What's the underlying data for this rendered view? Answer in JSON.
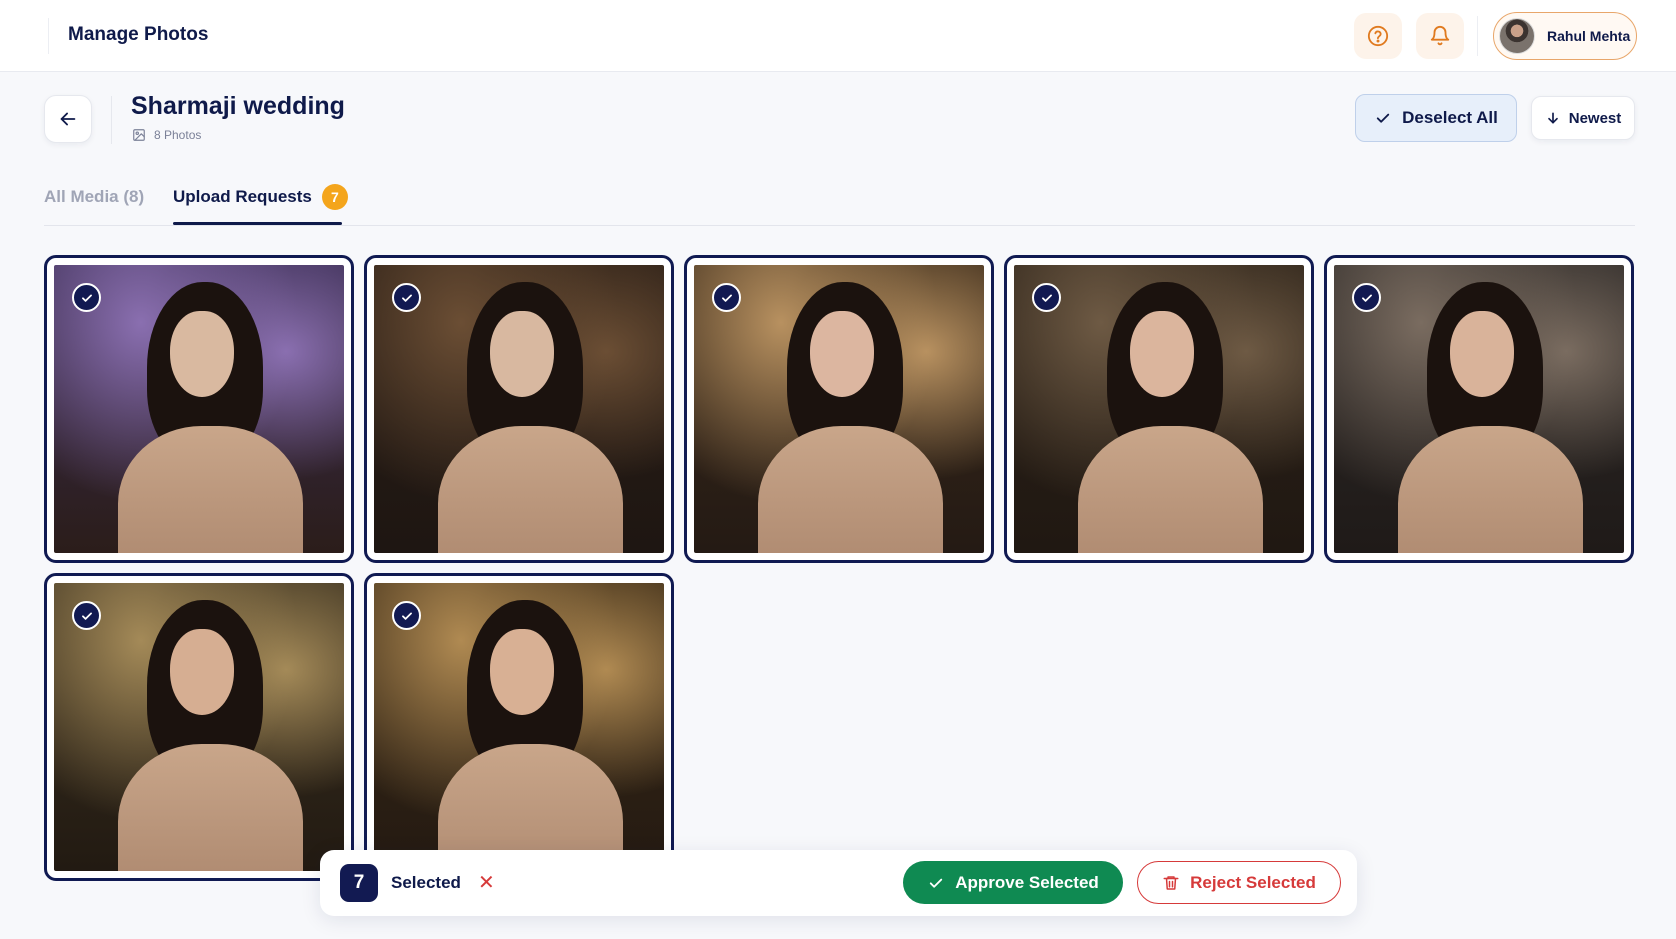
{
  "topbar": {
    "app_title": "Manage Photos",
    "help_icon": "help-circle-icon",
    "bell_icon": "bell-icon",
    "user_name": "Rahul Mehta"
  },
  "header": {
    "album_title": "Sharmaji wedding",
    "photo_count": "8 Photos",
    "deselect_label": "Deselect All",
    "sort_label": "Newest"
  },
  "tabs": [
    {
      "label": "All Media (8)",
      "active": false
    },
    {
      "label": "Upload Requests",
      "badge": "7",
      "active": true
    }
  ],
  "photos": [
    {
      "selected": true
    },
    {
      "selected": true
    },
    {
      "selected": true
    },
    {
      "selected": true
    },
    {
      "selected": true
    },
    {
      "selected": true
    },
    {
      "selected": true
    }
  ],
  "action_bar": {
    "selected_count": "7",
    "selected_label": "Selected",
    "clear_symbol": "✕",
    "approve_label": "Approve Selected",
    "reject_label": "Reject Selected"
  },
  "colors": {
    "navy": "#0f1a4a",
    "accent_orange": "#f4a51c",
    "approve_green": "#0f8a52",
    "reject_red": "#d63a3a"
  }
}
